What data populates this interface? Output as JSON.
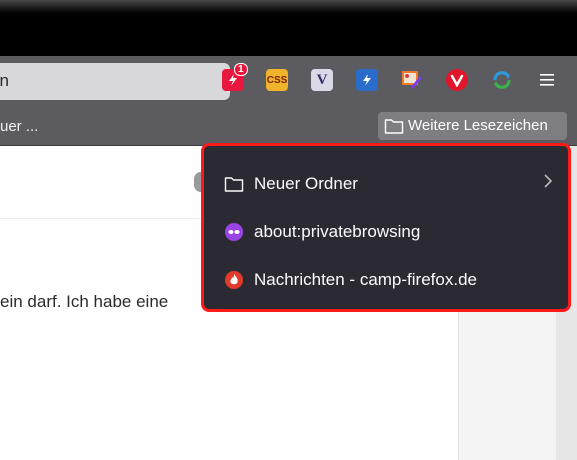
{
  "navbar": {
    "url_text": "en",
    "menu_icon": "hamburger-menu-icon",
    "extensions": [
      {
        "name": "extension-red-lightning-icon",
        "badge": "1",
        "color": "#e8173d"
      },
      {
        "name": "extension-css-icon",
        "label": "CSS",
        "color": "#f0b42c"
      },
      {
        "name": "extension-v-icon",
        "label": "V",
        "color": "#d9d9e8"
      },
      {
        "name": "extension-blue-lightning-icon",
        "color": "#2a6cc9"
      },
      {
        "name": "extension-edit-image-icon",
        "color": "#f07a2c"
      },
      {
        "name": "extension-vivaldi-icon",
        "color": "#e0162b"
      },
      {
        "name": "extension-sync-icon",
        "color": "#2a9be0"
      }
    ]
  },
  "bookmarks_bar": {
    "left_item": "uer ...",
    "more_bookmarks": "Weitere Lesezeichen"
  },
  "content": {
    "text": "ein darf. Ich habe eine"
  },
  "dropdown": {
    "items": [
      {
        "label": "Neuer Ordner",
        "icon": "folder-icon"
      },
      {
        "label": "about:privatebrowsing",
        "icon": "private-browsing-icon"
      },
      {
        "label": "Nachrichten - camp-firefox.de",
        "icon": "camp-firefox-icon"
      }
    ],
    "accent": "#ff1a1a"
  }
}
